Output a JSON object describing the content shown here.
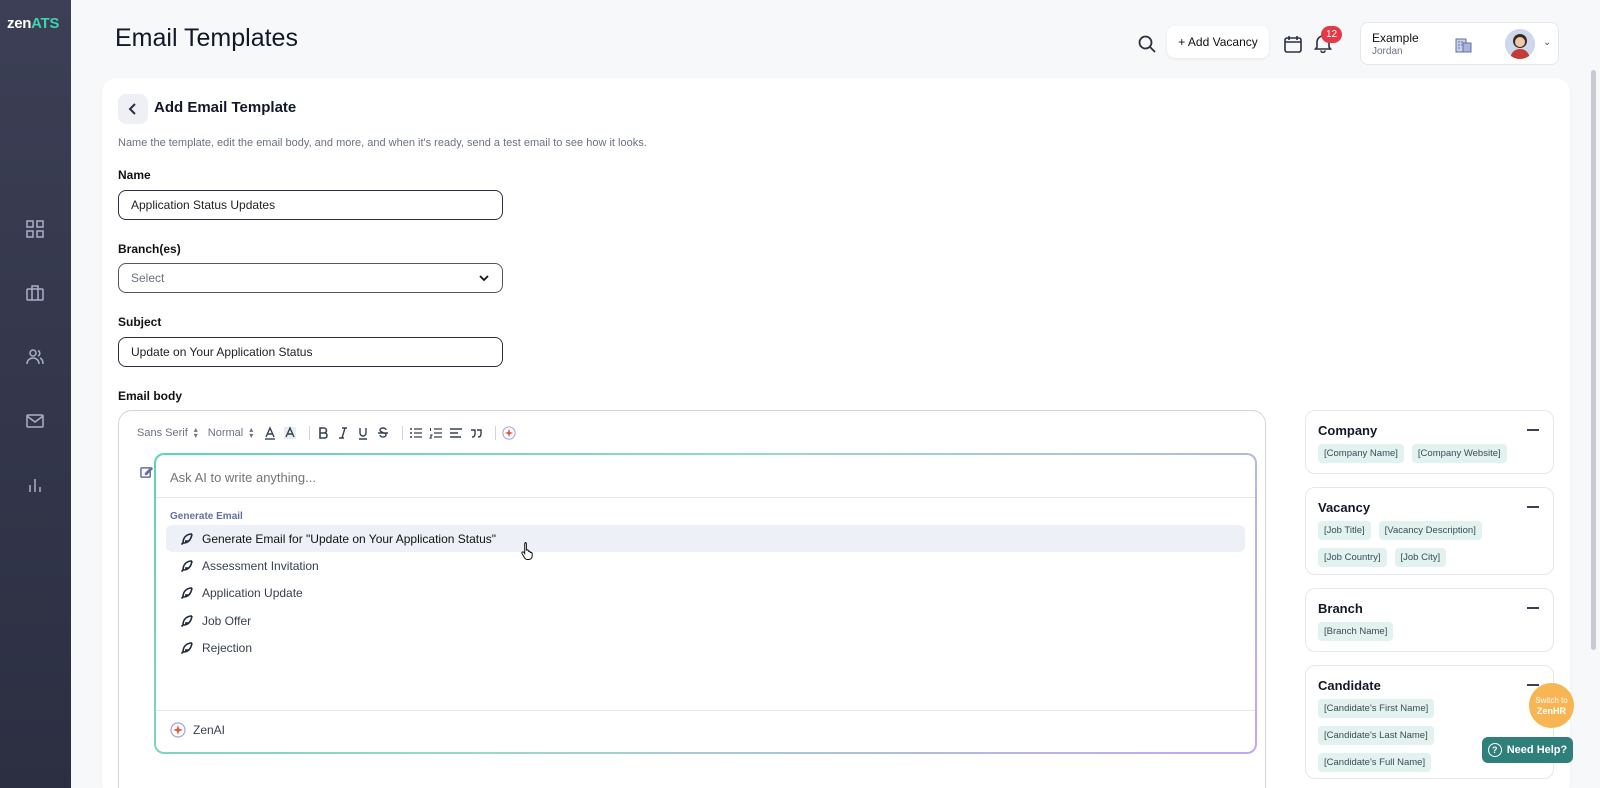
{
  "app": {
    "logo_zen": "zen",
    "logo_ats": "ATS"
  },
  "sidebar": {
    "items": [
      {
        "icon": "dashboard-icon"
      },
      {
        "icon": "briefcase-icon"
      },
      {
        "icon": "people-icon"
      },
      {
        "icon": "mail-icon"
      },
      {
        "icon": "chart-icon"
      }
    ]
  },
  "header": {
    "page_title": "Email Templates",
    "add_vacancy_label": "+ Add Vacancy",
    "notification_count": "12",
    "company": "Example",
    "user": "Jordan"
  },
  "form": {
    "title": "Add Email Template",
    "description": "Name the template, edit the email body, and more, and when it's ready, send a test email to see how it looks.",
    "name_label": "Name",
    "name_value": "Application Status Updates",
    "branch_label": "Branch(es)",
    "branch_placeholder": "Select",
    "subject_label": "Subject",
    "subject_value": "Update on Your Application Status",
    "body_label": "Email body"
  },
  "toolbar": {
    "font": "Sans Serif",
    "size": "Normal"
  },
  "ai": {
    "placeholder": "Ask AI to write anything...",
    "section_label": "Generate Email",
    "items": [
      "Generate Email for \"Update on Your Application Status\"",
      "Assessment Invitation",
      "Application Update",
      "Job Offer",
      "Rejection"
    ],
    "footer": "ZenAI"
  },
  "variables": {
    "company": {
      "title": "Company",
      "tags": [
        "[Company Name]",
        "[Company Website]"
      ]
    },
    "vacancy": {
      "title": "Vacancy",
      "tags": [
        "[Job Title]",
        "[Vacancy Description]",
        "[Job Country]",
        "[Job City]"
      ]
    },
    "branch": {
      "title": "Branch",
      "tags": [
        "[Branch Name]"
      ]
    },
    "candidate": {
      "title": "Candidate",
      "tags": [
        "[Candidate's First Name]",
        "[Candidate's Last Name]",
        "[Candidate's Full Name]"
      ]
    }
  },
  "floating": {
    "switch_line1": "Switch to",
    "switch_line2": "ZenHR",
    "help": "Need Help?"
  },
  "colors": {
    "sidebar": "#2c2f42",
    "accent_teal": "#3fd1b0",
    "tag_bg": "#e2f2ee",
    "help_bg": "#2f7f7a",
    "switch_bg": "#f8b553",
    "badge": "#e53946"
  }
}
